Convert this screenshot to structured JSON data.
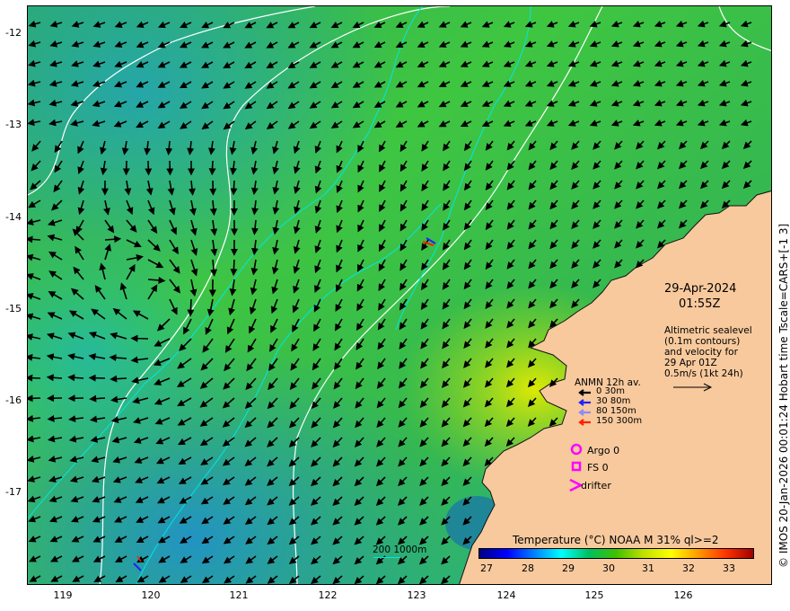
{
  "map": {
    "y_ticks": [
      "-12",
      "-13",
      "-14",
      "-15",
      "-16",
      "-17"
    ],
    "x_ticks": [
      "119",
      "120",
      "121",
      "122",
      "123",
      "124",
      "125",
      "126"
    ],
    "land_color": "#f7c99d",
    "sea_colors": [
      "#2fae59",
      "#3fc640",
      "#23b5a8",
      "#1fa0c8",
      "#b8e000",
      "#e8e800"
    ],
    "contour_white": "#ffffff",
    "contour_cyan": "#00e6e6"
  },
  "info": {
    "date": "29-Apr-2024",
    "time": "01:55Z",
    "altimetry_lines": [
      "Altimetric sealevel",
      "(0.1m contours)",
      "and velocity for",
      "29 Apr 01Z",
      "0.5m/s (1kt 24h)"
    ]
  },
  "anmn_legend": {
    "title": "ANMN 12h av.",
    "items": [
      {
        "label": "0 30m",
        "color": "#000000"
      },
      {
        "label": "30 80m",
        "color": "#1e22ff"
      },
      {
        "label": "80 150m",
        "color": "#8a8aff"
      },
      {
        "label": "150 300m",
        "color": "#ff2000"
      }
    ]
  },
  "obs_legend": {
    "argo": "Argo 0",
    "fs": "FS 0",
    "drifter": "drifter",
    "marker_color": "#ff00ff"
  },
  "colorbar": {
    "title": "Temperature (°C) NOAA  M 31% ql>=2",
    "ticks": [
      "27",
      "28",
      "29",
      "30",
      "31",
      "32",
      "33"
    ],
    "colors": [
      "#00007f",
      "#0000ff",
      "#0080ff",
      "#00ffff",
      "#00c060",
      "#40c000",
      "#c0e000",
      "#ffff00",
      "#ff9900",
      "#ff3300",
      "#a00000"
    ]
  },
  "depth_scale": {
    "label": "200  1000m"
  },
  "credit": "© IMOS 20-Jan-2026 00:01:24 Hobart time Tscale=CARS+[-1 3]"
}
